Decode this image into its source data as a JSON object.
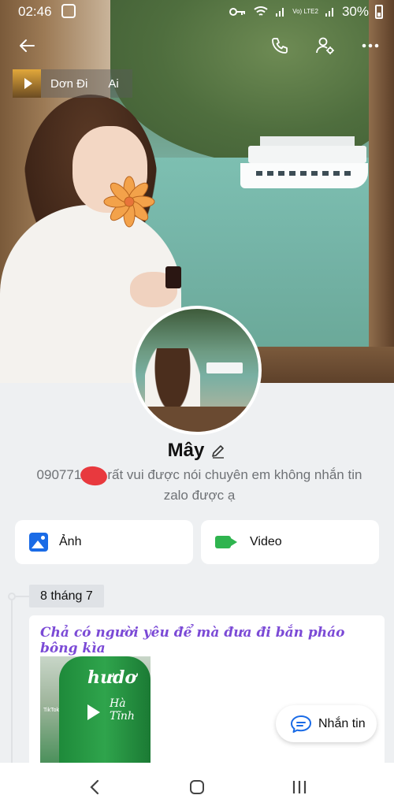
{
  "status_bar": {
    "time": "02:46",
    "network": "Vo) LTE2",
    "battery": "30%"
  },
  "header": {
    "music": {
      "title": "Dơn Đi",
      "artist": "Ai"
    }
  },
  "profile": {
    "name": "Mây",
    "bio_line1": "090771391",
    "bio_line1_rest": "rất vui được nói chuyên em không  nhắn tin",
    "bio_line2": "zalo được ạ"
  },
  "media_tiles": {
    "photos_label": "Ảnh",
    "videos_label": "Video"
  },
  "timeline": {
    "date": "8 tháng 7",
    "post_caption": "Chả có người yêu để mà đưa đi bắn pháo bông kìa",
    "thumb_label": "hưdơ",
    "thumb_label2": "Hà Tĩnh",
    "thumb_watermark": "TikTok"
  },
  "chat_button": {
    "label": "Nhắn tin"
  },
  "colors": {
    "accent_blue": "#1a6be6",
    "video_green": "#2fb44f",
    "caption_purple": "#7b4ad6",
    "chat_icon": "#1a6be6"
  }
}
